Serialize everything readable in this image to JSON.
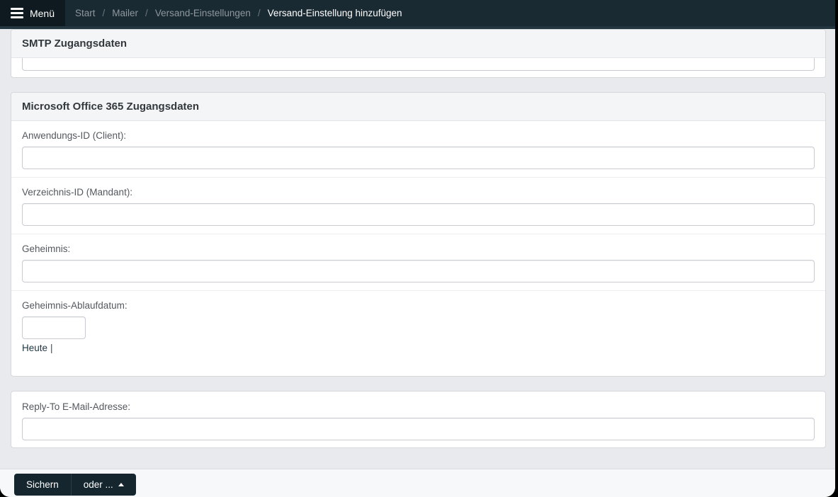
{
  "navbar": {
    "menu_label": "Menü",
    "separator": "/",
    "breadcrumbs": [
      {
        "label": "Start"
      },
      {
        "label": "Mailer"
      },
      {
        "label": "Versand-Einstellungen"
      },
      {
        "label": "Versand-Einstellung hinzufügen"
      }
    ]
  },
  "smtp_panel": {
    "title": "SMTP Zugangsdaten",
    "clipped_input_value": ""
  },
  "office365_panel": {
    "title": "Microsoft Office 365 Zugangsdaten",
    "fields": [
      {
        "label": "Anwendungs-ID (Client):",
        "value": ""
      },
      {
        "label": "Verzeichnis-ID (Mandant):",
        "value": ""
      },
      {
        "label": "Geheimnis:",
        "value": ""
      },
      {
        "label": "Geheimnis-Ablaufdatum:",
        "value": ""
      }
    ],
    "date_quick_link": "Heute",
    "date_quick_separator": "|"
  },
  "reply_panel": {
    "label": "Reply-To E-Mail-Adresse:",
    "value": ""
  },
  "footer": {
    "save_label": "Sichern",
    "or_label": "oder ..."
  },
  "colors": {
    "navbar_bg": "#1a2a32",
    "navbar_edge": "#243640",
    "menu_button_bg": "#0f1a20",
    "content_bg": "#e9eaee",
    "panel_header_bg": "#f4f5f6",
    "button_bg": "#15262e",
    "link_dark": "#1f3642",
    "window_backdrop": "#000000"
  }
}
